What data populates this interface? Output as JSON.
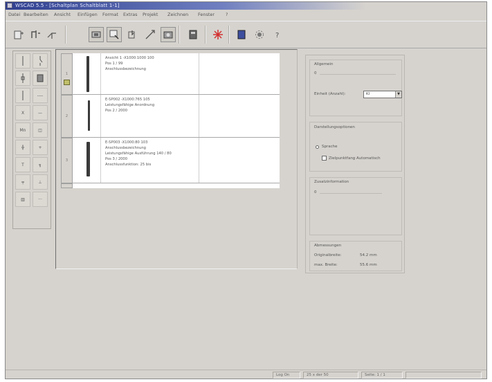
{
  "window": {
    "title": "WSCAD 5.5 - [Schaltplan Schaltblatt 1-1]"
  },
  "menu": [
    "Datei",
    "Bearbeiten",
    "Ansicht",
    "Einfügen",
    "Format",
    "Extras",
    "Projekt",
    "Zeichnen",
    "Fenster",
    "?"
  ],
  "toolbar": {
    "icons": [
      "new-page-icon",
      "bus-icon",
      "wire-icon",
      "terminal-icon",
      "insert-icon",
      "pointer-icon",
      "connection-icon",
      "photo-icon",
      "document-icon",
      "cross-icon",
      "book-icon",
      "settings-icon",
      "help-icon"
    ]
  },
  "rows": [
    {
      "number": "1",
      "lines": [
        "Ansicht 1 -X1000:1000 100",
        "Pos 1 / 99",
        "Anschlussbezeichnung"
      ]
    },
    {
      "number": "2",
      "lines": [
        "E-SP002 -X1000:765 105",
        "Leistungsfähige Anordnung",
        "Pos 2 / 2000"
      ]
    },
    {
      "number": "3",
      "lines": [
        "E-SP003 -X1000:80 103",
        "Anschlussbezeichnung",
        "Leistungsfähige Ausführung 140 / 80",
        "Pos 3 / 2000",
        "Anschlussfunktion: 25 bis"
      ]
    }
  ],
  "properties": {
    "group1": {
      "title": "Allgemein",
      "field1_value": "0",
      "select_label": "Einheit (Anzahl):",
      "select_value": "Kl"
    },
    "group2": {
      "title": "Darstellungsoptionen",
      "option_radio": "Sprache",
      "option_check": "Zielpunktfang Automatisch"
    },
    "group3": {
      "title": "Zusatzinformation",
      "value": "0"
    },
    "group4": {
      "title": "Abmessungen",
      "row1_label": "Originalbreite:",
      "row1_value": "54.2 mm",
      "row2_label": "max. Breite:",
      "row2_value": "55.6 mm"
    }
  },
  "status": {
    "panel1": "Log On",
    "panel2": "25 x der 50",
    "panel3": "Seite: 1 / 1"
  }
}
